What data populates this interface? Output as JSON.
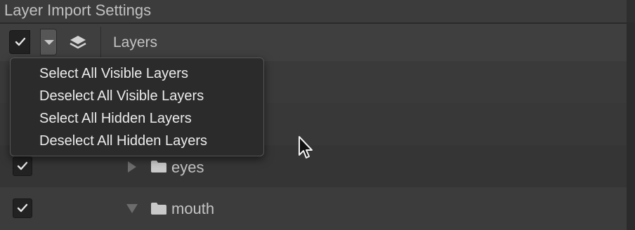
{
  "panel": {
    "title": "Layer Import Settings"
  },
  "header": {
    "master_checked": true,
    "layers_label": "Layers"
  },
  "rows": [
    {
      "label": "eyes",
      "checked": true,
      "expanded": false,
      "icon": "folder-icon"
    },
    {
      "label": "mouth",
      "checked": true,
      "expanded": true,
      "icon": "folder-icon"
    }
  ],
  "menu": {
    "items": [
      "Select All Visible Layers",
      "Deselect All Visible Layers",
      "Select All Hidden Layers",
      "Deselect All Hidden Layers"
    ]
  },
  "colors": {
    "background": "#383838",
    "menu_background": "#2b2b2b",
    "menu_text": "#ececec",
    "text": "#c4c4c4"
  }
}
